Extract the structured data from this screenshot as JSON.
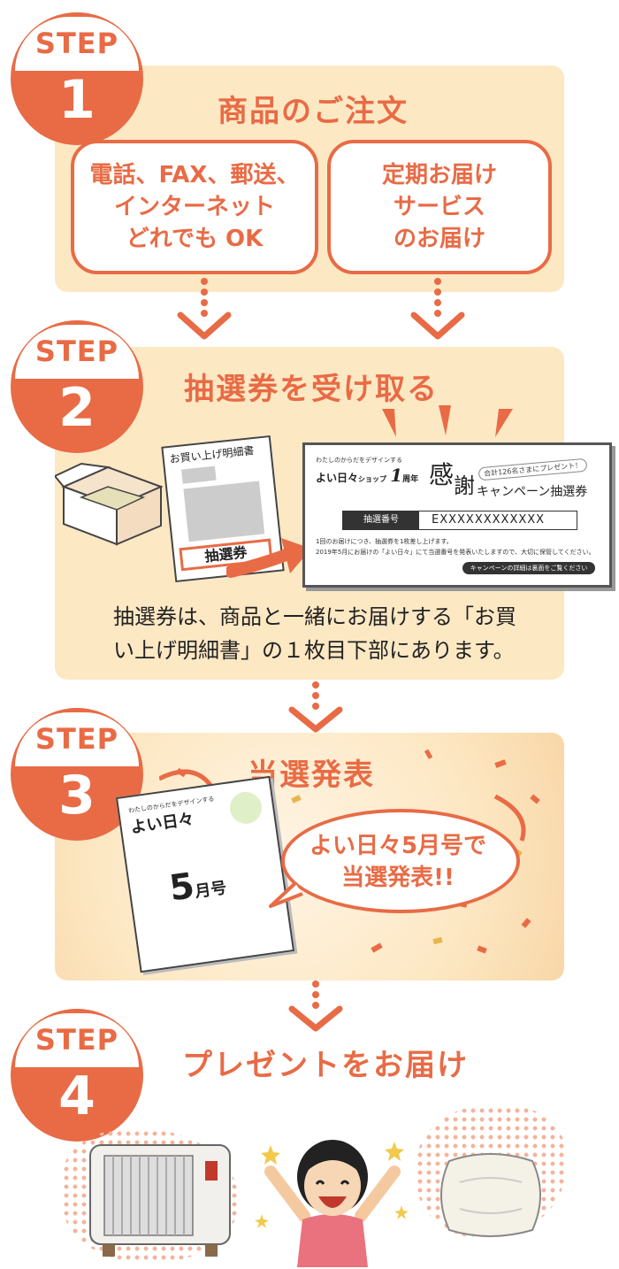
{
  "step1": {
    "label": "STEP",
    "number": "1",
    "title": "商品のご注文",
    "options": [
      {
        "lines": [
          "電話、FAX、郵送、",
          "インターネット",
          "どれでも OK"
        ]
      },
      {
        "lines": [
          "定期お届け",
          "サービス",
          "のお届け"
        ]
      }
    ]
  },
  "step2": {
    "label": "STEP",
    "number": "2",
    "title": "抽選券を受け取る",
    "invoice_title": "お買い上げ明細書",
    "invoice_ticket": "抽選券",
    "ticket": {
      "tagline": "わたしのからだをデザインする",
      "brand": "よい日々",
      "shop": "ショップ",
      "anniv_num": "1",
      "anniv_unit": "周年",
      "kanji1": "感",
      "kanji2": "謝",
      "gift": "合計126名さまにプレゼント！",
      "campaign": "キャンペーン抽選券",
      "number_label": "抽選番号",
      "number_value": "EXXXXXXXXXXXX",
      "line1": "1回のお届けにつき、抽選券を1枚差し上げます。",
      "line2": "2019年5月にお届けの「よい日々」にて当選番号を発表いたしますので、大切に保管してください。",
      "details_button": "キャンペーンの詳細は裏面をご覧ください"
    },
    "note_lines": [
      "抽選券は、商品と一緒にお届けする「お買",
      "い上げ明細書」の１枚目下部にあります。"
    ]
  },
  "step3": {
    "label": "STEP",
    "number": "3",
    "title": "当選発表",
    "magazine_tagline": "わたしのからだをデザインする",
    "magazine_brand": "よい日々",
    "magazine_issue_num": "5",
    "magazine_issue_unit": "月号",
    "bubble_lines": [
      "よい日々5月号で",
      "当選発表!!"
    ]
  },
  "step4": {
    "label": "STEP",
    "number": "4",
    "title": "プレゼントをお届け"
  },
  "colors": {
    "accent": "#e86b45",
    "panel": "#fde8c4"
  }
}
